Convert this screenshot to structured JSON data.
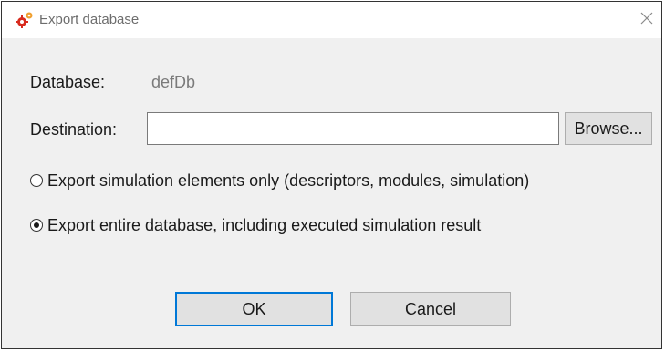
{
  "window": {
    "title": "Export database",
    "icon": "gears-icon",
    "close_icon": "close-icon"
  },
  "database": {
    "label": "Database:",
    "value": "defDb"
  },
  "destination": {
    "label": "Destination:",
    "value": "",
    "browse_label": "Browse..."
  },
  "options": [
    {
      "label": "Export simulation elements only (descriptors, modules, simulation)",
      "checked": false
    },
    {
      "label": "Export entire database, including executed simulation result",
      "checked": true
    }
  ],
  "buttons": {
    "ok_label": "OK",
    "cancel_label": "Cancel"
  },
  "colors": {
    "accent": "#0078d7",
    "icon_red": "#d82b1e",
    "icon_orange": "#f0a030"
  }
}
